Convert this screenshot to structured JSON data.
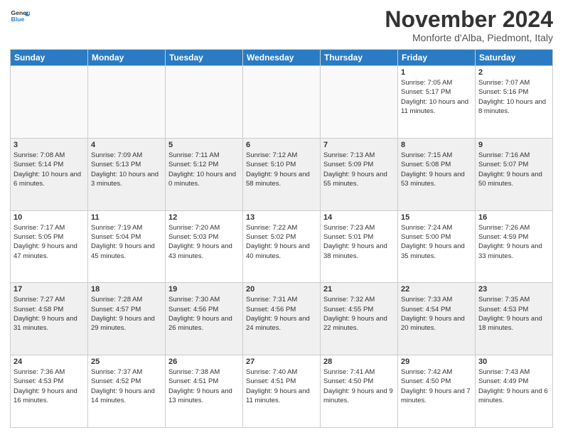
{
  "logo": {
    "line1": "General",
    "line2": "Blue"
  },
  "title": "November 2024",
  "subtitle": "Monforte d'Alba, Piedmont, Italy",
  "weekdays": [
    "Sunday",
    "Monday",
    "Tuesday",
    "Wednesday",
    "Thursday",
    "Friday",
    "Saturday"
  ],
  "weeks": [
    [
      {
        "day": "",
        "info": ""
      },
      {
        "day": "",
        "info": ""
      },
      {
        "day": "",
        "info": ""
      },
      {
        "day": "",
        "info": ""
      },
      {
        "day": "",
        "info": ""
      },
      {
        "day": "1",
        "info": "Sunrise: 7:05 AM\nSunset: 5:17 PM\nDaylight: 10 hours and 11 minutes."
      },
      {
        "day": "2",
        "info": "Sunrise: 7:07 AM\nSunset: 5:16 PM\nDaylight: 10 hours and 8 minutes."
      }
    ],
    [
      {
        "day": "3",
        "info": "Sunrise: 7:08 AM\nSunset: 5:14 PM\nDaylight: 10 hours and 6 minutes."
      },
      {
        "day": "4",
        "info": "Sunrise: 7:09 AM\nSunset: 5:13 PM\nDaylight: 10 hours and 3 minutes."
      },
      {
        "day": "5",
        "info": "Sunrise: 7:11 AM\nSunset: 5:12 PM\nDaylight: 10 hours and 0 minutes."
      },
      {
        "day": "6",
        "info": "Sunrise: 7:12 AM\nSunset: 5:10 PM\nDaylight: 9 hours and 58 minutes."
      },
      {
        "day": "7",
        "info": "Sunrise: 7:13 AM\nSunset: 5:09 PM\nDaylight: 9 hours and 55 minutes."
      },
      {
        "day": "8",
        "info": "Sunrise: 7:15 AM\nSunset: 5:08 PM\nDaylight: 9 hours and 53 minutes."
      },
      {
        "day": "9",
        "info": "Sunrise: 7:16 AM\nSunset: 5:07 PM\nDaylight: 9 hours and 50 minutes."
      }
    ],
    [
      {
        "day": "10",
        "info": "Sunrise: 7:17 AM\nSunset: 5:05 PM\nDaylight: 9 hours and 47 minutes."
      },
      {
        "day": "11",
        "info": "Sunrise: 7:19 AM\nSunset: 5:04 PM\nDaylight: 9 hours and 45 minutes."
      },
      {
        "day": "12",
        "info": "Sunrise: 7:20 AM\nSunset: 5:03 PM\nDaylight: 9 hours and 43 minutes."
      },
      {
        "day": "13",
        "info": "Sunrise: 7:22 AM\nSunset: 5:02 PM\nDaylight: 9 hours and 40 minutes."
      },
      {
        "day": "14",
        "info": "Sunrise: 7:23 AM\nSunset: 5:01 PM\nDaylight: 9 hours and 38 minutes."
      },
      {
        "day": "15",
        "info": "Sunrise: 7:24 AM\nSunset: 5:00 PM\nDaylight: 9 hours and 35 minutes."
      },
      {
        "day": "16",
        "info": "Sunrise: 7:26 AM\nSunset: 4:59 PM\nDaylight: 9 hours and 33 minutes."
      }
    ],
    [
      {
        "day": "17",
        "info": "Sunrise: 7:27 AM\nSunset: 4:58 PM\nDaylight: 9 hours and 31 minutes."
      },
      {
        "day": "18",
        "info": "Sunrise: 7:28 AM\nSunset: 4:57 PM\nDaylight: 9 hours and 29 minutes."
      },
      {
        "day": "19",
        "info": "Sunrise: 7:30 AM\nSunset: 4:56 PM\nDaylight: 9 hours and 26 minutes."
      },
      {
        "day": "20",
        "info": "Sunrise: 7:31 AM\nSunset: 4:56 PM\nDaylight: 9 hours and 24 minutes."
      },
      {
        "day": "21",
        "info": "Sunrise: 7:32 AM\nSunset: 4:55 PM\nDaylight: 9 hours and 22 minutes."
      },
      {
        "day": "22",
        "info": "Sunrise: 7:33 AM\nSunset: 4:54 PM\nDaylight: 9 hours and 20 minutes."
      },
      {
        "day": "23",
        "info": "Sunrise: 7:35 AM\nSunset: 4:53 PM\nDaylight: 9 hours and 18 minutes."
      }
    ],
    [
      {
        "day": "24",
        "info": "Sunrise: 7:36 AM\nSunset: 4:53 PM\nDaylight: 9 hours and 16 minutes."
      },
      {
        "day": "25",
        "info": "Sunrise: 7:37 AM\nSunset: 4:52 PM\nDaylight: 9 hours and 14 minutes."
      },
      {
        "day": "26",
        "info": "Sunrise: 7:38 AM\nSunset: 4:51 PM\nDaylight: 9 hours and 13 minutes."
      },
      {
        "day": "27",
        "info": "Sunrise: 7:40 AM\nSunset: 4:51 PM\nDaylight: 9 hours and 11 minutes."
      },
      {
        "day": "28",
        "info": "Sunrise: 7:41 AM\nSunset: 4:50 PM\nDaylight: 9 hours and 9 minutes."
      },
      {
        "day": "29",
        "info": "Sunrise: 7:42 AM\nSunset: 4:50 PM\nDaylight: 9 hours and 7 minutes."
      },
      {
        "day": "30",
        "info": "Sunrise: 7:43 AM\nSunset: 4:49 PM\nDaylight: 9 hours and 6 minutes."
      }
    ]
  ]
}
